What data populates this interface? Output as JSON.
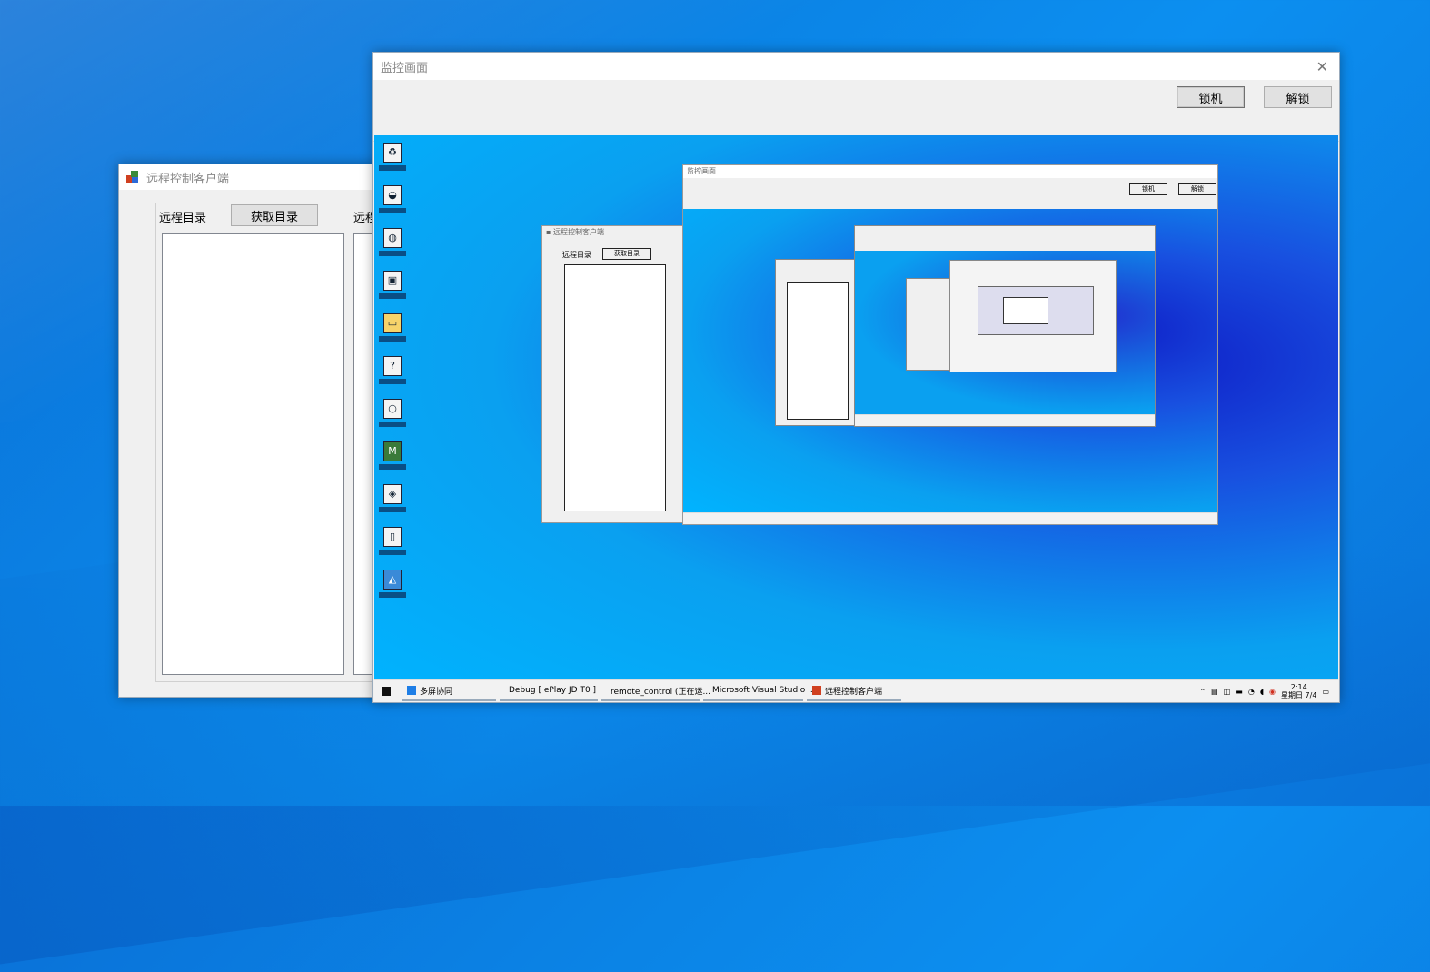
{
  "client_window": {
    "title": "远程控制客户端",
    "dir_label": "远程目录",
    "get_dir_button": "获取目录",
    "second_label": "远程"
  },
  "monitor_window": {
    "title": "监控画面",
    "lock_button": "锁机",
    "unlock_button": "解锁"
  },
  "remote_screen": {
    "desktop_icons": [
      "recycle-bin",
      "qq",
      "app",
      "app",
      "folder",
      "app",
      "app",
      "app",
      "app",
      "file",
      "photos"
    ],
    "inner_monitor_title": "监控画面",
    "inner_client_labels": {
      "dir_label": "远程目录",
      "get_dir_button": "获取目录"
    },
    "taskbar": {
      "items": [
        "多屏协同",
        "Debug [ ePlay JD T0 ]",
        "remote_control (正在运...",
        "Microsoft Visual Studio ...",
        "远程控制客户端"
      ],
      "time": "2:14",
      "date": "星期日 7/4"
    }
  },
  "colors": {
    "desktop_bg": "#0b84e6",
    "window_bg": "#f0f0f0",
    "button_bg": "#e1e1e1"
  }
}
